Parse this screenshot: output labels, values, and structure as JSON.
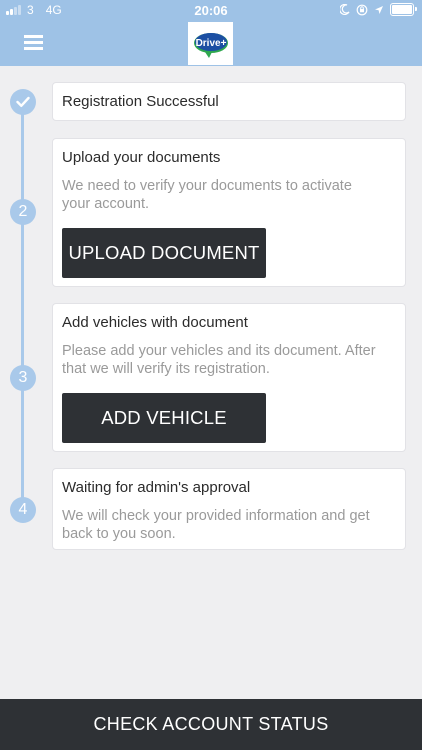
{
  "status_bar": {
    "carrier": "3",
    "network": "4G",
    "time": "20:06"
  },
  "header": {
    "logo_text": "Drive+"
  },
  "steps": [
    {
      "marker": "check",
      "title": "Registration Successful"
    },
    {
      "marker": "2",
      "title": "Upload your documents",
      "description": "We need to verify your documents to activate your account.",
      "button_label": "UPLOAD DOCUMENT"
    },
    {
      "marker": "3",
      "title": "Add vehicles with document",
      "description": "Please add your vehicles and its document. After that we will verify its registration.",
      "button_label": "ADD VEHICLE"
    },
    {
      "marker": "4",
      "title": "Waiting for admin's approval",
      "description": "We will check your provided information and get back to you soon."
    }
  ],
  "footer": {
    "button_label": "CHECK ACCOUNT STATUS"
  },
  "colors": {
    "header_bg": "#9ec2e6",
    "timeline": "#a9c9ea",
    "dark_button": "#2e3135",
    "logo_blue": "#1c4fa3",
    "logo_green": "#2fa84f"
  }
}
